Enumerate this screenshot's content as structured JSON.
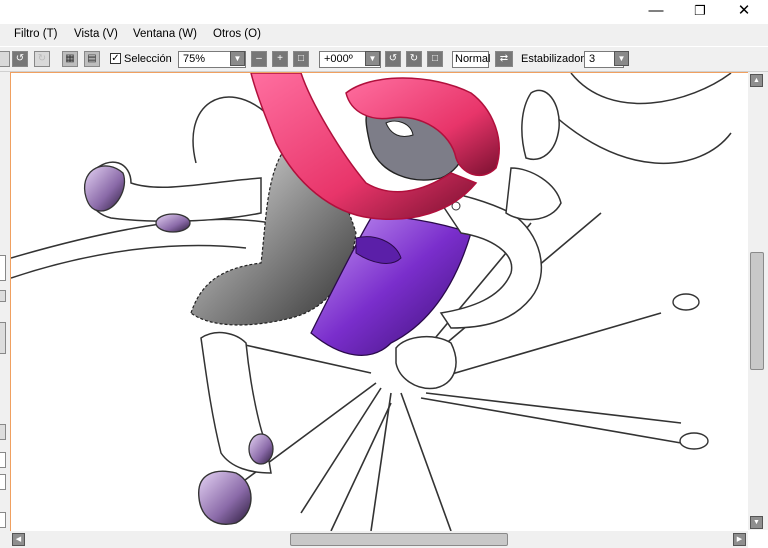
{
  "window": {
    "minimize_glyph": "—",
    "restore_glyph": "❐",
    "close_glyph": "✕"
  },
  "menu": {
    "items": [
      {
        "label": "Filtro (T)"
      },
      {
        "label": "Vista (V)"
      },
      {
        "label": "Ventana (W)"
      },
      {
        "label": "Otros (O)"
      }
    ]
  },
  "toolbar": {
    "selection_checked": true,
    "selection_label": "Selección",
    "zoom_value": "75%",
    "rotation_value": "+000º",
    "blend_mode": "Normal",
    "stabilizer_label": "Estabilizador",
    "stabilizer_value": "3"
  },
  "canvas": {
    "border_color": "#f0a060",
    "hood_color": "#e8356a",
    "sash_color": "#7a2ecc"
  },
  "icons": [
    "minimize-icon",
    "restore-icon",
    "close-icon",
    "undo-icon",
    "redo-icon",
    "zoom-out-icon",
    "zoom-in-icon",
    "rotate-left-icon",
    "rotate-right-icon",
    "flip-icon"
  ]
}
